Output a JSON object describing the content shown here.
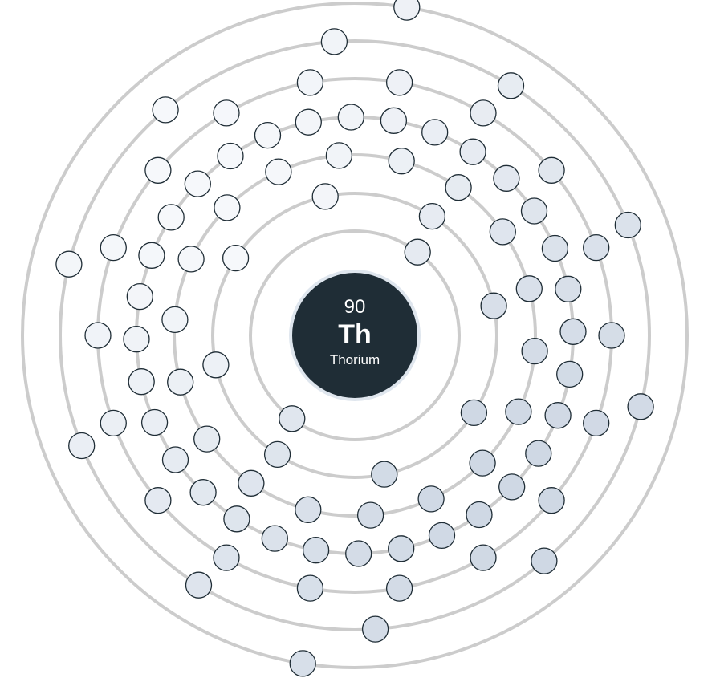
{
  "element": {
    "atomic_number": "90",
    "symbol": "Th",
    "name": "Thorium"
  },
  "electron_configuration": {
    "electrons_per_shell": [
      2,
      8,
      18,
      32,
      18,
      10,
      2
    ]
  },
  "colors": {
    "nucleus": "#1f2d36",
    "shell_line": "#cccccc",
    "electron_stroke": "#1f2d36",
    "electron_fill_light": "#f6f8fb",
    "electron_fill_dark": "#cfd8e4"
  }
}
